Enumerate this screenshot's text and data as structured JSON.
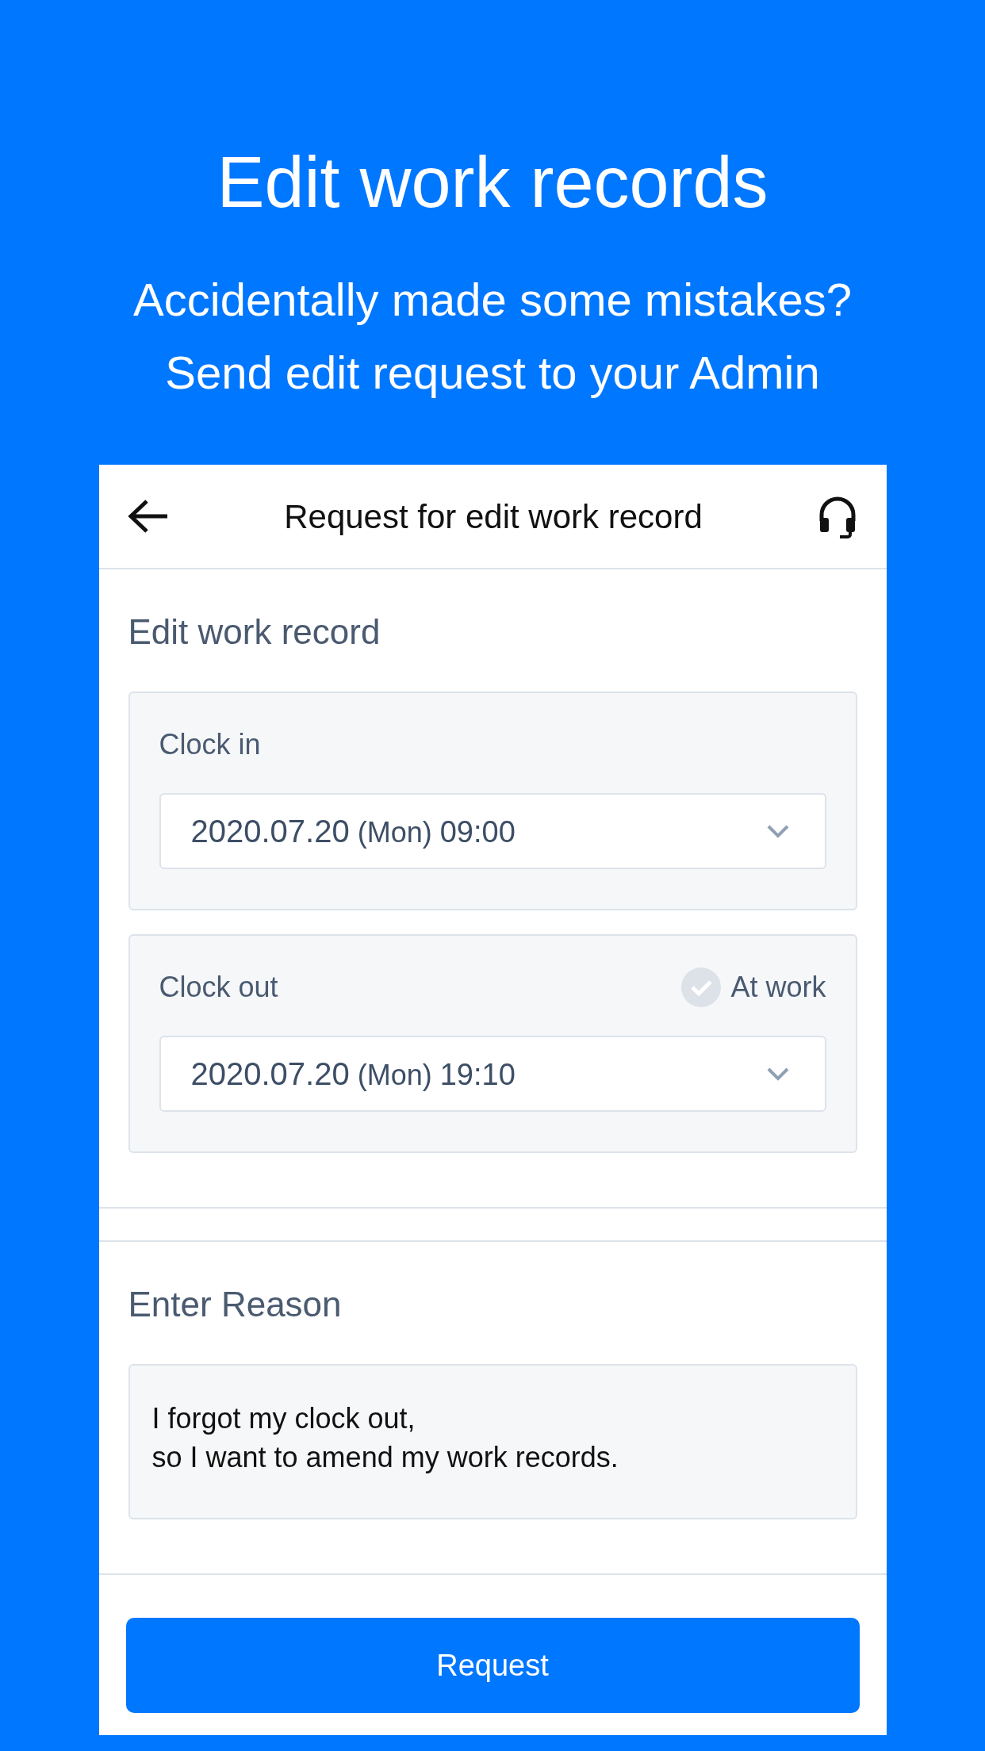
{
  "headline": "Edit work records",
  "subtitle_lines": [
    "Accidentally made some mistakes?",
    "Send edit request to your Admin"
  ],
  "screen": {
    "title": "Request for edit work record",
    "section_title": "Edit work record",
    "fields": [
      {
        "label": "Clock in",
        "date": "2020.07.20",
        "weekday": "(Mon)",
        "time": "09:00"
      },
      {
        "label": "Clock out",
        "date": "2020.07.20",
        "weekday": "(Mon)",
        "time": "19:10",
        "toggle": {
          "label": "At work",
          "checked": false
        }
      }
    ],
    "reason_title": "Enter Reason",
    "reason_lines": [
      "I forgot my clock out,",
      "so I want to amend my work records."
    ],
    "button": "Request"
  }
}
